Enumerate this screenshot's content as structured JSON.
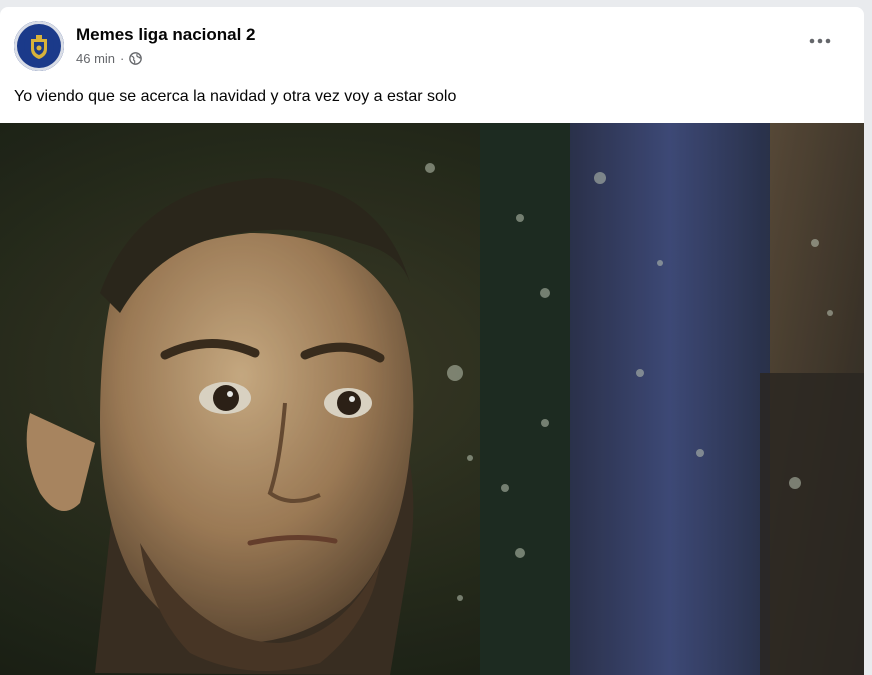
{
  "post": {
    "page_name": "Memes liga nacional 2",
    "timestamp": "46 min",
    "separator": "·",
    "privacy_icon": "globe-icon",
    "more_icon": "more-options-icon",
    "caption": "Yo viendo que se acerca la navidad y otra vez voy a estar solo",
    "image_description_icon": "meme-photo"
  },
  "colors": {
    "card_bg": "#ffffff",
    "page_bg": "#e9ebee",
    "text_primary": "#050505",
    "text_secondary": "#65676b",
    "avatar_blue": "#1b3a8a",
    "avatar_gold": "#d8b23a"
  }
}
